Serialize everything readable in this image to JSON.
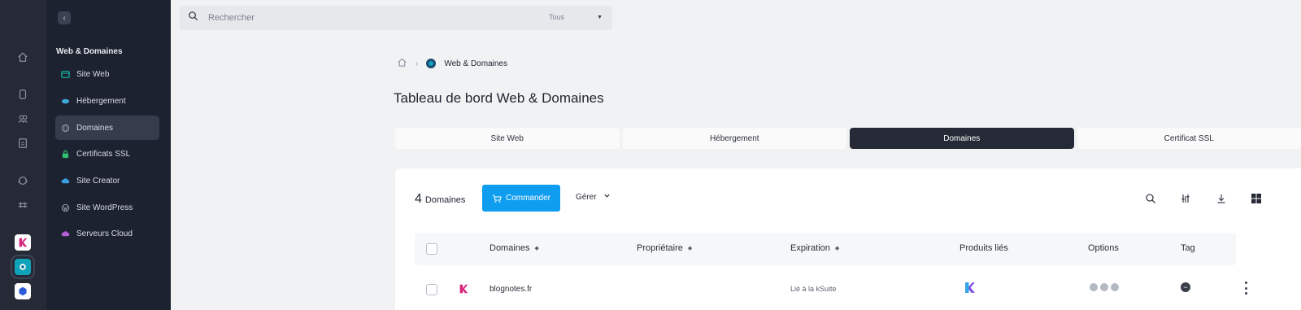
{
  "colors": {
    "rail_bg": "#252a36",
    "sidebar_bg": "#1d2230",
    "accent": "#0f9df0",
    "tab_active": "#252a36"
  },
  "rail": {
    "icons": [
      "home-icon",
      "database-icon",
      "users-icon",
      "invoice-icon",
      "support-icon",
      "ticket-icon"
    ],
    "apps": [
      "kchat-app-icon",
      "web-domains-app-icon",
      "kdrive-app-icon"
    ]
  },
  "sidebar": {
    "title": "Web & Domaines",
    "items": [
      {
        "label": "Site Web",
        "icon": "website-icon",
        "color": "#13b8a6"
      },
      {
        "label": "Hébergement",
        "icon": "hosting-icon",
        "color": "#3ba8d8"
      },
      {
        "label": "Domaines",
        "icon": "globe-icon",
        "color": "#8f96a6",
        "active": true
      },
      {
        "label": "Certificats SSL",
        "icon": "lock-icon",
        "color": "#2fbf71"
      },
      {
        "label": "Site Creator",
        "icon": "cloud-icon",
        "color": "#3aa0e6"
      },
      {
        "label": "Site WordPress",
        "icon": "wordpress-icon",
        "color": "#8f96a6"
      },
      {
        "label": "Serveurs Cloud",
        "icon": "server-cloud-icon",
        "color": "#b35fd6"
      }
    ]
  },
  "search": {
    "placeholder": "Rechercher",
    "scope": "Tous"
  },
  "breadcrumb": {
    "current": "Web & Domaines"
  },
  "page": {
    "title": "Tableau de bord Web & Domaines"
  },
  "tabs": [
    {
      "label": "Site Web",
      "active": false
    },
    {
      "label": "Hébergement",
      "active": false
    },
    {
      "label": "Domaines",
      "active": true
    },
    {
      "label": "Certificat SSL",
      "active": false
    }
  ],
  "toolbar": {
    "count": "4",
    "count_label": "Domaines",
    "order_label": "Commander",
    "manage_label": "Gérer"
  },
  "table": {
    "columns": {
      "domain": "Domaines",
      "owner": "Propriétaire",
      "expiration": "Expiration",
      "products": "Produits liés",
      "options": "Options",
      "tag": "Tag"
    },
    "rows": [
      {
        "domain": "blognotes.fr",
        "owner": "",
        "expiration": "Lié à la kSuite",
        "product_icon": "kchat-logo-icon",
        "tag_icon": "tag-minus-icon"
      }
    ]
  }
}
